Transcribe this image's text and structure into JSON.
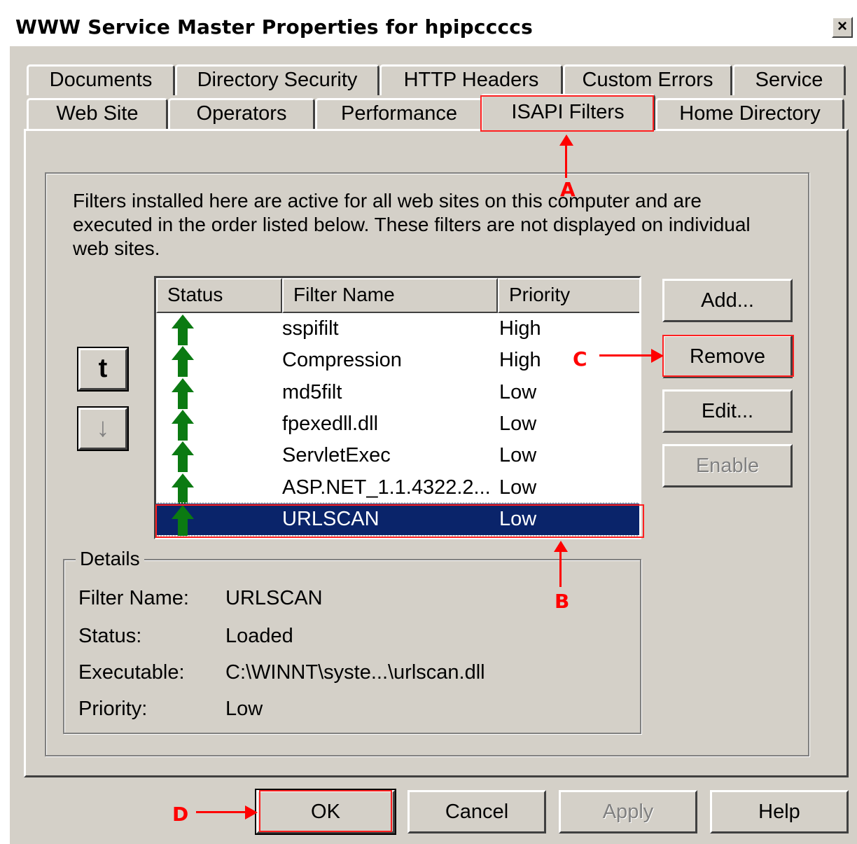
{
  "window": {
    "title": "WWW Service Master Properties for hpipccccs",
    "close_label": "×"
  },
  "tabs_back": [
    {
      "label": "Documents"
    },
    {
      "label": "Directory Security"
    },
    {
      "label": "HTTP Headers"
    },
    {
      "label": "Custom Errors"
    },
    {
      "label": "Service"
    }
  ],
  "tabs_front": [
    {
      "label": "Web Site"
    },
    {
      "label": "Operators"
    },
    {
      "label": "Performance"
    },
    {
      "label": "ISAPI Filters"
    },
    {
      "label": "Home Directory"
    }
  ],
  "active_tab": "ISAPI Filters",
  "description": "Filters installed here are active for all web sites on this computer and are executed in the order listed below.  These filters are not displayed on individual web sites.",
  "filter_list": {
    "columns": [
      "Status",
      "Filter Name",
      "Priority"
    ],
    "rows": [
      {
        "status": "loaded-arrow",
        "name": "sspifilt",
        "priority": "High"
      },
      {
        "status": "loaded-arrow",
        "name": "Compression",
        "priority": "High"
      },
      {
        "status": "loaded-arrow",
        "name": "md5filt",
        "priority": "Low"
      },
      {
        "status": "loaded-arrow",
        "name": "fpexedll.dll",
        "priority": "Low"
      },
      {
        "status": "loaded-arrow",
        "name": "ServletExec",
        "priority": "Low"
      },
      {
        "status": "loaded-arrow",
        "name": "ASP.NET_1.1.4322.2...",
        "priority": "Low"
      },
      {
        "status": "loaded-arrow",
        "name": "URLSCAN",
        "priority": "Low",
        "selected": true
      }
    ]
  },
  "move_buttons": {
    "up_glyph": "t",
    "down_glyph": "↓"
  },
  "side_buttons": {
    "add": "Add...",
    "remove": "Remove",
    "edit": "Edit...",
    "enable": "Enable"
  },
  "details": {
    "legend": "Details",
    "filter_name_label": "Filter Name:",
    "filter_name_value": "URLSCAN",
    "status_label": "Status:",
    "status_value": "Loaded",
    "executable_label": "Executable:",
    "executable_value": "C:\\WINNT\\syste...\\urlscan.dll",
    "priority_label": "Priority:",
    "priority_value": "Low"
  },
  "bottom_buttons": {
    "ok": "OK",
    "cancel": "Cancel",
    "apply": "Apply",
    "help": "Help"
  },
  "annotations": {
    "a": "A",
    "b": "B",
    "c": "C",
    "d": "D"
  },
  "colors": {
    "dialog_bg": "#d4d0c8",
    "selection": "#0a246a",
    "status_arrow": "#0b7a12",
    "annotation_red": "#ff0000"
  }
}
